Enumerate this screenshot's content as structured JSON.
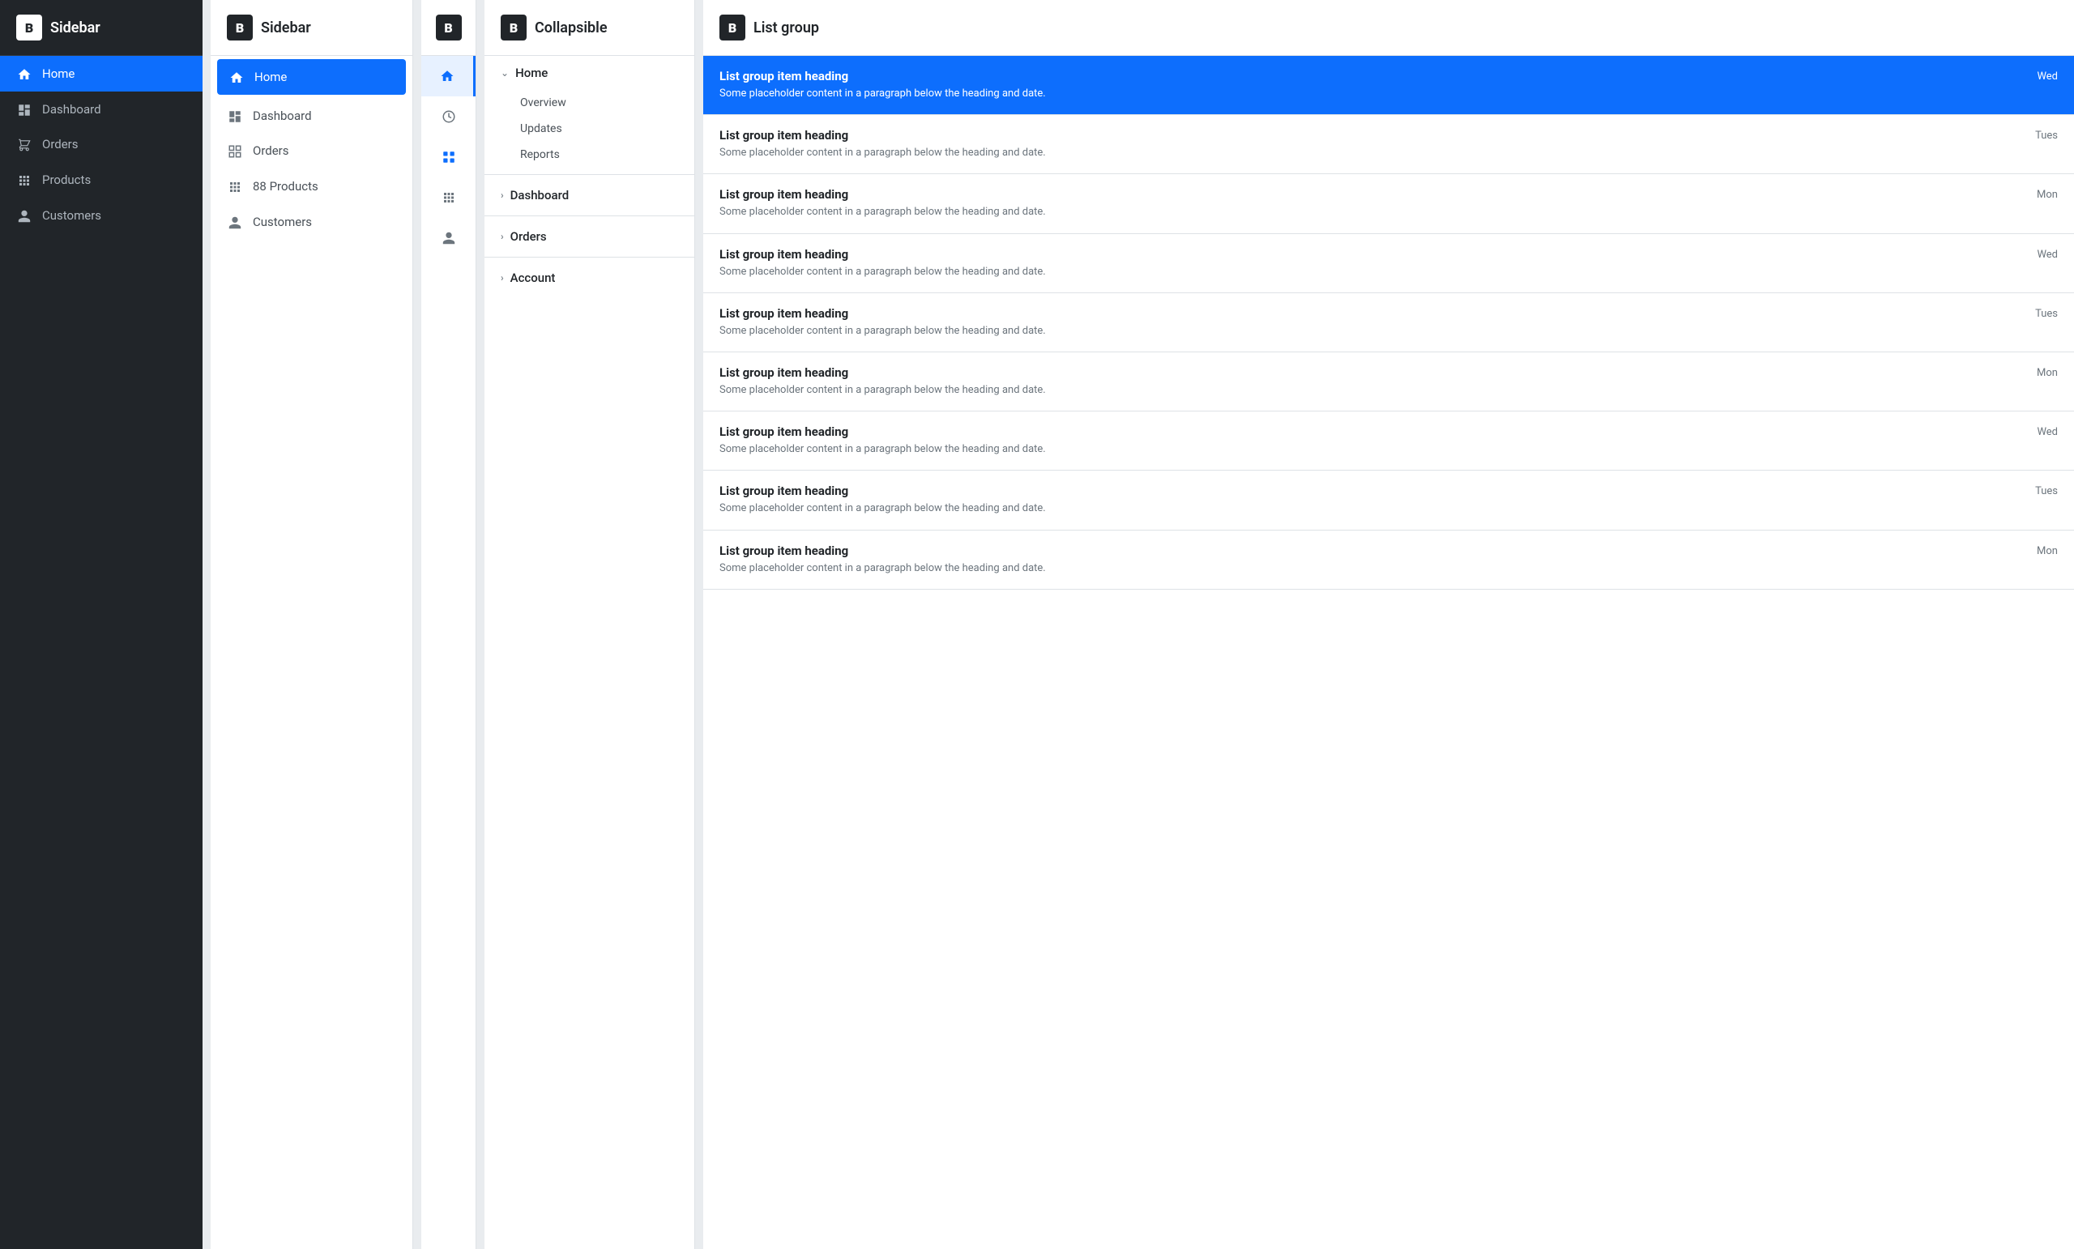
{
  "panels": {
    "panel1": {
      "title": "Sidebar",
      "brand": "B",
      "nav_items": [
        {
          "id": "home",
          "label": "Home",
          "icon": "home",
          "active": true
        },
        {
          "id": "dashboard",
          "label": "Dashboard",
          "icon": "dashboard",
          "active": false
        },
        {
          "id": "orders",
          "label": "Orders",
          "icon": "orders",
          "active": false
        },
        {
          "id": "products",
          "label": "Products",
          "icon": "products",
          "active": false
        },
        {
          "id": "customers",
          "label": "Customers",
          "icon": "customers",
          "active": false
        }
      ]
    },
    "panel2": {
      "title": "Sidebar",
      "brand": "B",
      "nav_items": [
        {
          "id": "home",
          "label": "Home",
          "icon": "home",
          "active": true
        },
        {
          "id": "dashboard",
          "label": "Dashboard",
          "icon": "dashboard",
          "active": false
        },
        {
          "id": "orders",
          "label": "Orders",
          "icon": "orders",
          "active": false
        },
        {
          "id": "products",
          "label": "88 Products",
          "icon": "products",
          "active": false
        },
        {
          "id": "customers",
          "label": "Customers",
          "icon": "customers",
          "active": false
        }
      ]
    },
    "panel3": {
      "brand": "B",
      "icon_items": [
        {
          "id": "home",
          "icon": "home",
          "active": true
        },
        {
          "id": "dashboard",
          "icon": "dashboard",
          "active": false
        },
        {
          "id": "orders",
          "icon": "orders",
          "active": true
        },
        {
          "id": "products",
          "icon": "products",
          "active": false
        },
        {
          "id": "customers",
          "icon": "customers",
          "active": false
        }
      ]
    },
    "panel4": {
      "title": "Collapsible",
      "brand": "B",
      "items": [
        {
          "id": "home",
          "label": "Home",
          "expanded": true,
          "sub_items": [
            {
              "id": "overview",
              "label": "Overview"
            },
            {
              "id": "updates",
              "label": "Updates"
            },
            {
              "id": "reports",
              "label": "Reports"
            }
          ]
        },
        {
          "id": "dashboard",
          "label": "Dashboard",
          "expanded": false,
          "sub_items": []
        },
        {
          "id": "orders",
          "label": "Orders",
          "expanded": false,
          "sub_items": []
        },
        {
          "id": "account",
          "label": "Account",
          "expanded": false,
          "sub_items": []
        }
      ]
    },
    "panel5": {
      "title": "List group",
      "brand": "B",
      "items": [
        {
          "id": "item1",
          "heading": "List group item heading",
          "text": "Some placeholder content in a paragraph below the heading and date.",
          "badge": "Wed",
          "active": true
        },
        {
          "id": "item2",
          "heading": "List group item heading",
          "text": "Some placeholder content in a paragraph below the heading and date.",
          "badge": "Tues",
          "active": false
        },
        {
          "id": "item3",
          "heading": "List group item heading",
          "text": "Some placeholder content in a paragraph below the heading and date.",
          "badge": "Mon",
          "active": false
        },
        {
          "id": "item4",
          "heading": "List group item heading",
          "text": "Some placeholder content in a paragraph below the heading and date.",
          "badge": "Wed",
          "active": false
        },
        {
          "id": "item5",
          "heading": "List group item heading",
          "text": "Some placeholder content in a paragraph below the heading and date.",
          "badge": "Tues",
          "active": false
        },
        {
          "id": "item6",
          "heading": "List group item heading",
          "text": "Some placeholder content in a paragraph below the heading and date.",
          "badge": "Mon",
          "active": false
        },
        {
          "id": "item7",
          "heading": "List group item heading",
          "text": "Some placeholder content in a paragraph below the heading and date.",
          "badge": "Wed",
          "active": false
        },
        {
          "id": "item8",
          "heading": "List group item heading",
          "text": "Some placeholder content in a paragraph below the heading and date.",
          "badge": "Tues",
          "active": false
        },
        {
          "id": "item9",
          "heading": "List group item heading",
          "text": "Some placeholder content in a paragraph below the heading and date.",
          "badge": "Mon",
          "active": false
        }
      ]
    }
  }
}
